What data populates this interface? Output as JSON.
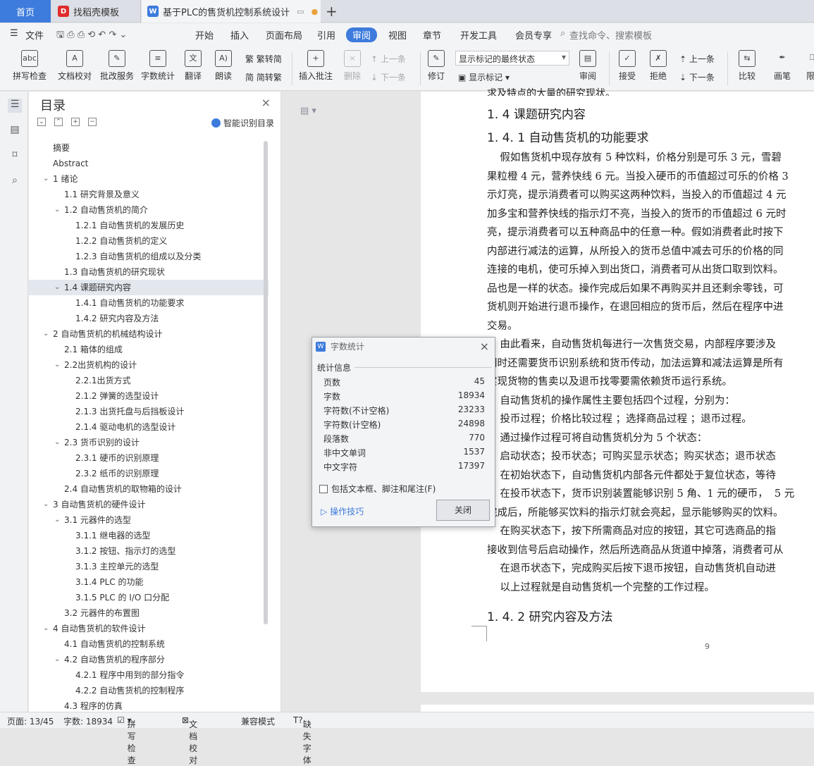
{
  "tabs": {
    "home": "首页",
    "template": "找稻壳模板",
    "doc": "基于PLC的售货机控制系统设计"
  },
  "menu": {
    "file": "文件",
    "items": [
      "开始",
      "插入",
      "页面布局",
      "引用",
      "审阅",
      "视图",
      "章节",
      "开发工具",
      "会员专享"
    ],
    "search": "查找命令、搜索模板"
  },
  "ribbon": {
    "spell": "拼写检查",
    "doccheck": "文档校对",
    "batch": "批改服务",
    "wordcount": "字数统计",
    "translate": "翻译",
    "read": "朗读",
    "trad": "繁转简",
    "simp": "简转繁",
    "insert_comment": "插入批注",
    "delete": "删除",
    "prev": "上一条",
    "next": "下一条",
    "revise": "修订",
    "markup_select": "显示标记的最终状态",
    "show_markup": "显示标记",
    "review": "审阅",
    "accept": "接受",
    "reject": "拒绝",
    "prev2": "上一条",
    "next2": "下一条",
    "compare": "比较",
    "pen": "画笔",
    "limit": "限"
  },
  "toc": {
    "title": "目录",
    "smart": "智能识别目录",
    "items": [
      {
        "t": "摘要",
        "l": 0
      },
      {
        "t": "Abstract",
        "l": 0
      },
      {
        "t": "1  绪论",
        "l": 1
      },
      {
        "t": "1.1 研究背景及意义",
        "l": 2
      },
      {
        "t": "1.2 自动售货机的简介",
        "l": 3
      },
      {
        "t": "1.2.1 自动售货机的发展历史",
        "l": 4
      },
      {
        "t": "1.2.2 自动售货机的定义",
        "l": 4
      },
      {
        "t": "1.2.3 自动售货机的组成以及分类",
        "l": 4
      },
      {
        "t": "1.3 自动售货机的研究现状",
        "l": 2
      },
      {
        "t": "1.4 课题研究内容",
        "l": 3
      },
      {
        "t": "1.4.1  自动售货机的功能要求",
        "l": 4
      },
      {
        "t": "1.4.2 研究内容及方法",
        "l": 4
      },
      {
        "t": "2 自动售货机的机械结构设计",
        "l": 1
      },
      {
        "t": "2.1  箱体的组成",
        "l": 2
      },
      {
        "t": "2.2出货机构的设计",
        "l": 3
      },
      {
        "t": "2.2.1出货方式",
        "l": 4
      },
      {
        "t": "2.1.2 弹簧的选型设计",
        "l": 4
      },
      {
        "t": "2.1.3 出货托盘与后挡板设计",
        "l": 4
      },
      {
        "t": "2.1.4 驱动电机的选型设计",
        "l": 4
      },
      {
        "t": "2.3 货币识别的设计",
        "l": 3
      },
      {
        "t": "2.3.1  硬币的识别原理",
        "l": 4
      },
      {
        "t": "2.3.2  纸币的识别原理",
        "l": 4
      },
      {
        "t": "2.4 自动售货机的取物箱的设计",
        "l": 2
      },
      {
        "t": "3 自动售货机的硬件设计",
        "l": 1
      },
      {
        "t": "3.1 元器件的选型",
        "l": 3
      },
      {
        "t": "3.1.1 继电器的选型",
        "l": 4
      },
      {
        "t": "3.1.2 按钮、指示灯的选型",
        "l": 4
      },
      {
        "t": "3.1.3 主控单元的选型",
        "l": 4
      },
      {
        "t": "3.1.4 PLC 的功能",
        "l": 4
      },
      {
        "t": "3.1.5 PLC 的 I/O 口分配",
        "l": 4
      },
      {
        "t": "3.2 元器件的布置图",
        "l": 2
      },
      {
        "t": "4  自动售货机的软件设计",
        "l": 1
      },
      {
        "t": "4.1  自动售货机的控制系统",
        "l": 2
      },
      {
        "t": "4.2  自动售货机的程序部分",
        "l": 3
      },
      {
        "t": "4.2.1  程序中用到的部分指令",
        "l": 4
      },
      {
        "t": "4.2.2  自动售货机的控制程序",
        "l": 4
      },
      {
        "t": "4.3  程序的仿真",
        "l": 2
      }
    ]
  },
  "doc": {
    "h_14": "1. 4 课题研究内容",
    "h_141": "1. 4. 1  自动售货机的功能要求",
    "lines": [
      "    假如售货机中现存放有 5 种饮料，价格分别是可乐 3 元，雪碧",
      "果粒橙 4 元，营养快线 6 元。当投入硬币的币值超过可乐的价格 3",
      "示灯亮，提示消费者可以购买这两种饮料，当投入的币值超过 4 元",
      "加多宝和营养快线的指示灯不亮，当投入的货币的币值超过 6 元时",
      "亮，提示消费者可以五种商品中的任意一种。假如消费者此时按下",
      "内部进行减法的运算，从所投入的货币总值中减去可乐的价格的同",
      "连接的电机，使可乐掉入到出货口，消费者可从出货口取到饮料。",
      "品也是一样的状态。操作完成后如果不再购买并且还剩余零钱，可",
      "货机则开始进行退币操作，在退回相应的货币后，然后在程序中进",
      "交易。",
      "    由此看来，自动售货机每进行一次售货交易，内部程序要涉及",
      "同时还需要货币识别系统和货币传动，加法运算和减法运算是所有",
      "实现货物的售卖以及退币找零要需依赖货币运行系统。",
      "    自动售货机的操作属性主要包括四个过程，分别为：",
      "    投币过程；价格比较过程 ；选择商品过程 ；退币过程。",
      "    通过操作过程可将自动售货机分为 5 个状态：",
      "    启动状态；投币状态；可购买显示状态；购买状态；退币状态",
      "    在初始状态下，自动售货机内部各元件都处于复位状态，等待",
      "    在投币状态下，货币识别装置能够识别 5 角、1 元的硬币，  5 元",
      "完成后，所能够买饮料的指示灯就会亮起，显示能够购买的饮料。",
      "    在购买状态下，按下所需商品对应的按钮，其它可选商品的指",
      "接收到信号后启动操作，然后所选商品从货道中掉落，消费者可从",
      "    在退币状态下，完成购买后按下退币按钮，自动售货机自动进",
      "    以上过程就是自动售货机一个完整的工作过程。"
    ],
    "h_142": "1. 4. 2 研究内容及方法",
    "page_num": "9"
  },
  "dialog": {
    "title": "字数统计",
    "section": "统计信息",
    "rows": [
      {
        "k": "页数",
        "v": "45"
      },
      {
        "k": "字数",
        "v": "18934"
      },
      {
        "k": "字符数(不计空格)",
        "v": "23233"
      },
      {
        "k": "字符数(计空格)",
        "v": "24898"
      },
      {
        "k": "段落数",
        "v": "770"
      },
      {
        "k": "非中文单词",
        "v": "1537"
      },
      {
        "k": "中文字符",
        "v": "17397"
      }
    ],
    "checkbox": "包括文本框、脚注和尾注(F)",
    "tips": "操作技巧",
    "close": "关闭"
  },
  "status": {
    "page": "页面: 13/45",
    "words": "字数: 18934",
    "spell": "拼写检查",
    "doccheck": "文档校对",
    "compat": "兼容模式",
    "missing_font": "缺失字体"
  }
}
